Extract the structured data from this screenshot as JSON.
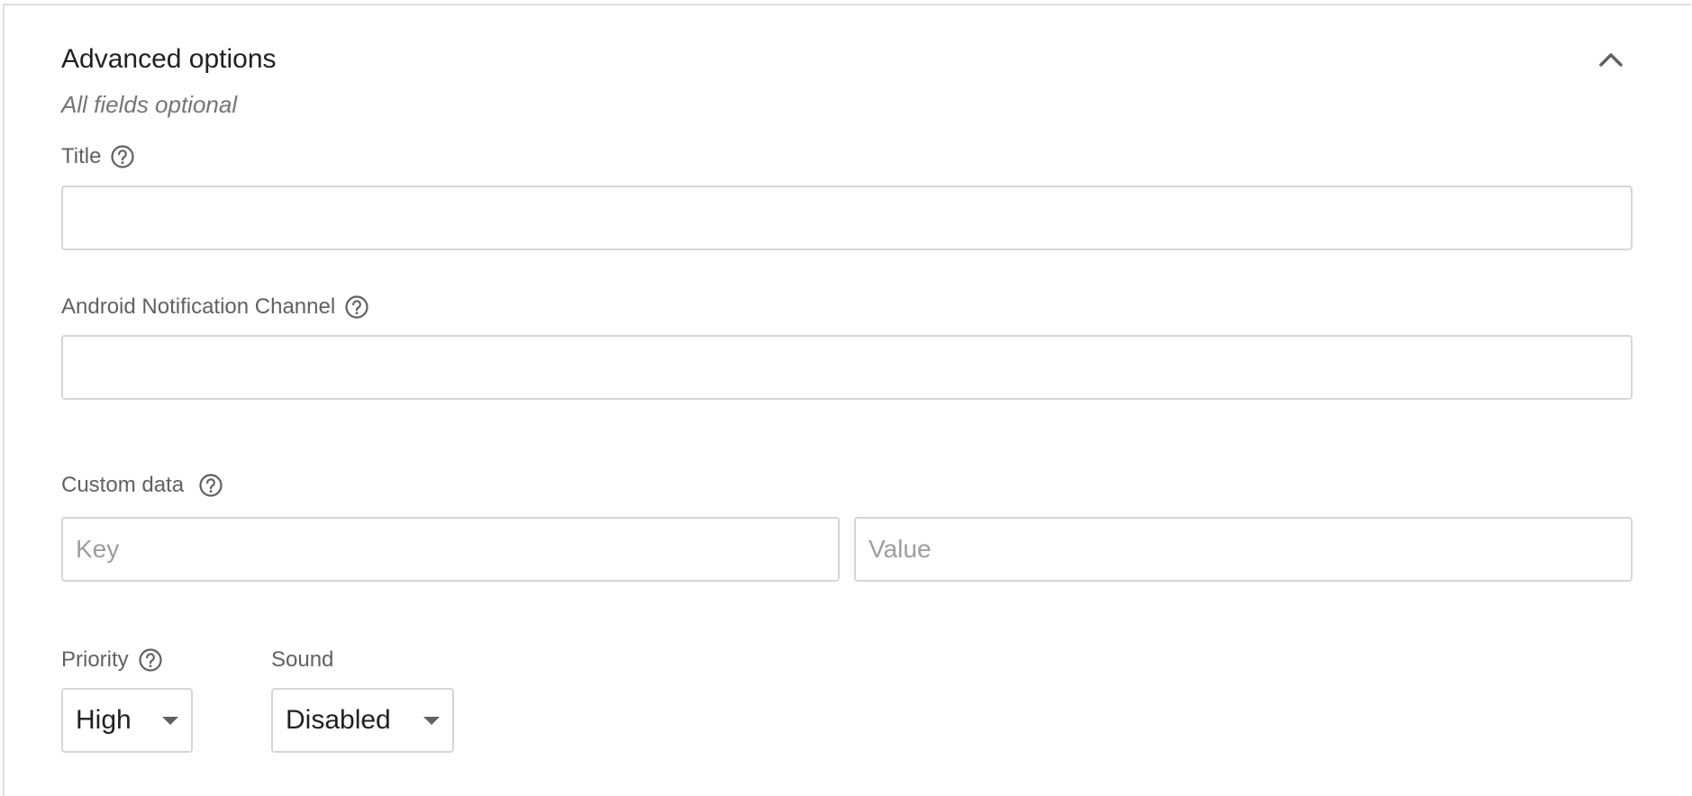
{
  "section": {
    "title": "Advanced options",
    "subtitle": "All fields optional",
    "collapse_icon": "chevron-up-icon"
  },
  "fields": {
    "title": {
      "label": "Title",
      "value": "",
      "help_icon": "help-circle-icon"
    },
    "android_channel": {
      "label": "Android Notification Channel",
      "value": "",
      "help_icon": "help-circle-icon"
    },
    "custom_data": {
      "label": "Custom data",
      "help_icon": "help-circle-icon",
      "key_placeholder": "Key",
      "value_placeholder": "Value"
    },
    "priority": {
      "label": "Priority",
      "selected": "High",
      "help_icon": "help-circle-icon"
    },
    "sound": {
      "label": "Sound",
      "selected": "Disabled"
    }
  },
  "colors": {
    "border": "#d6d6d6",
    "label": "#616161",
    "title": "#212121",
    "placeholder": "#9e9e9e"
  }
}
